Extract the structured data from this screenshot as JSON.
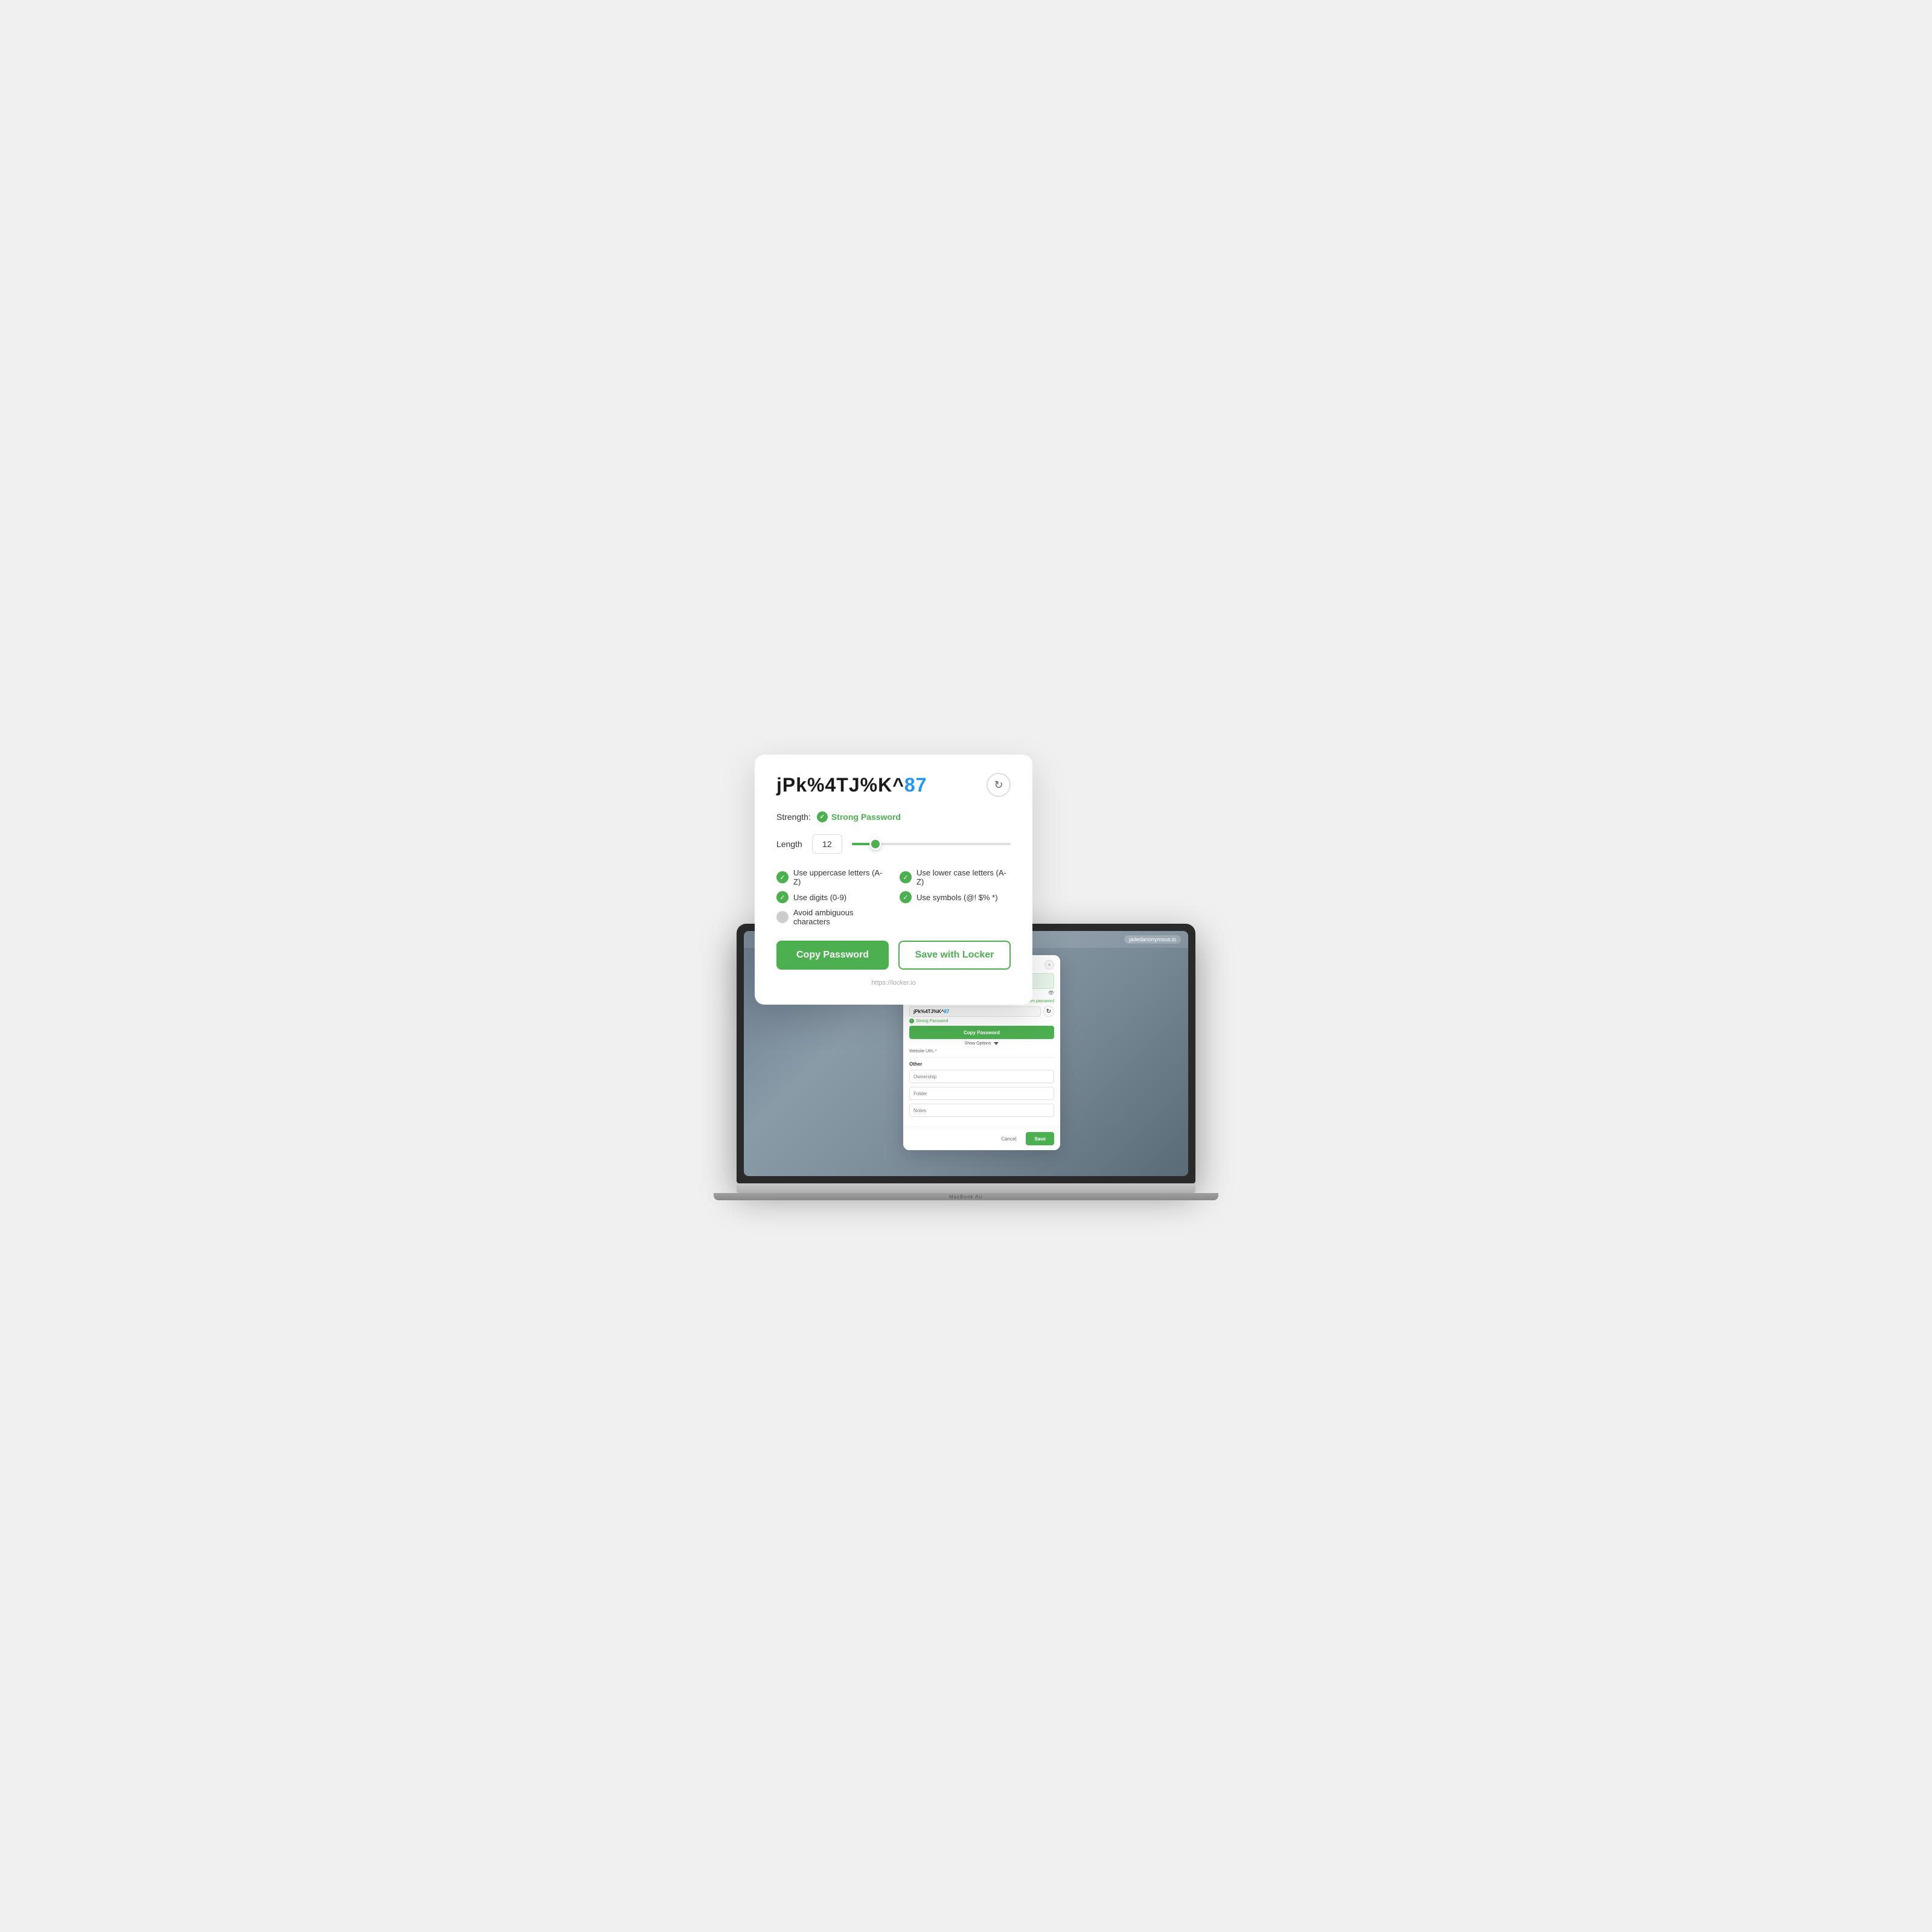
{
  "macbook": {
    "label": "MacBook Air",
    "topbar_user": "jadedanonymous.io"
  },
  "pw_generator": {
    "password": "jPk%4TJ%K^",
    "password_highlight": "87",
    "refresh_icon": "↻",
    "strength_label": "Strength:",
    "strength_value": "Strong Password",
    "length_label": "Length",
    "length_value": "12",
    "options": [
      {
        "label": "Use uppercase letters (A-Z)",
        "enabled": true
      },
      {
        "label": "Use lower case letters (A-Z)",
        "enabled": true
      },
      {
        "label": "Use digits (0-9)",
        "enabled": true
      },
      {
        "label": "Use symbols (@! $% *)",
        "enabled": true
      },
      {
        "label": "Avoid ambiguous characters",
        "enabled": false
      }
    ],
    "copy_btn": "Copy Password",
    "save_btn": "Save with Locker",
    "footer": "https://locker.io"
  },
  "modal": {
    "close_icon": "×",
    "generate_link": "Generate random password",
    "generated_password": "jPk%4TJ%K^",
    "generated_password_highlight": "87",
    "refresh_icon": "↻",
    "eye_icon": "👁",
    "strong_label": "Strong Password",
    "website_url_label": "Website URL *",
    "copy_pw_btn": "Copy Password",
    "show_options_label": "Show Options",
    "other_label": "Other",
    "ownership_label": "Ownership",
    "folder_label": "Folder",
    "notes_label": "Notes",
    "cancel_btn": "Cancel",
    "save_btn": "Save"
  }
}
